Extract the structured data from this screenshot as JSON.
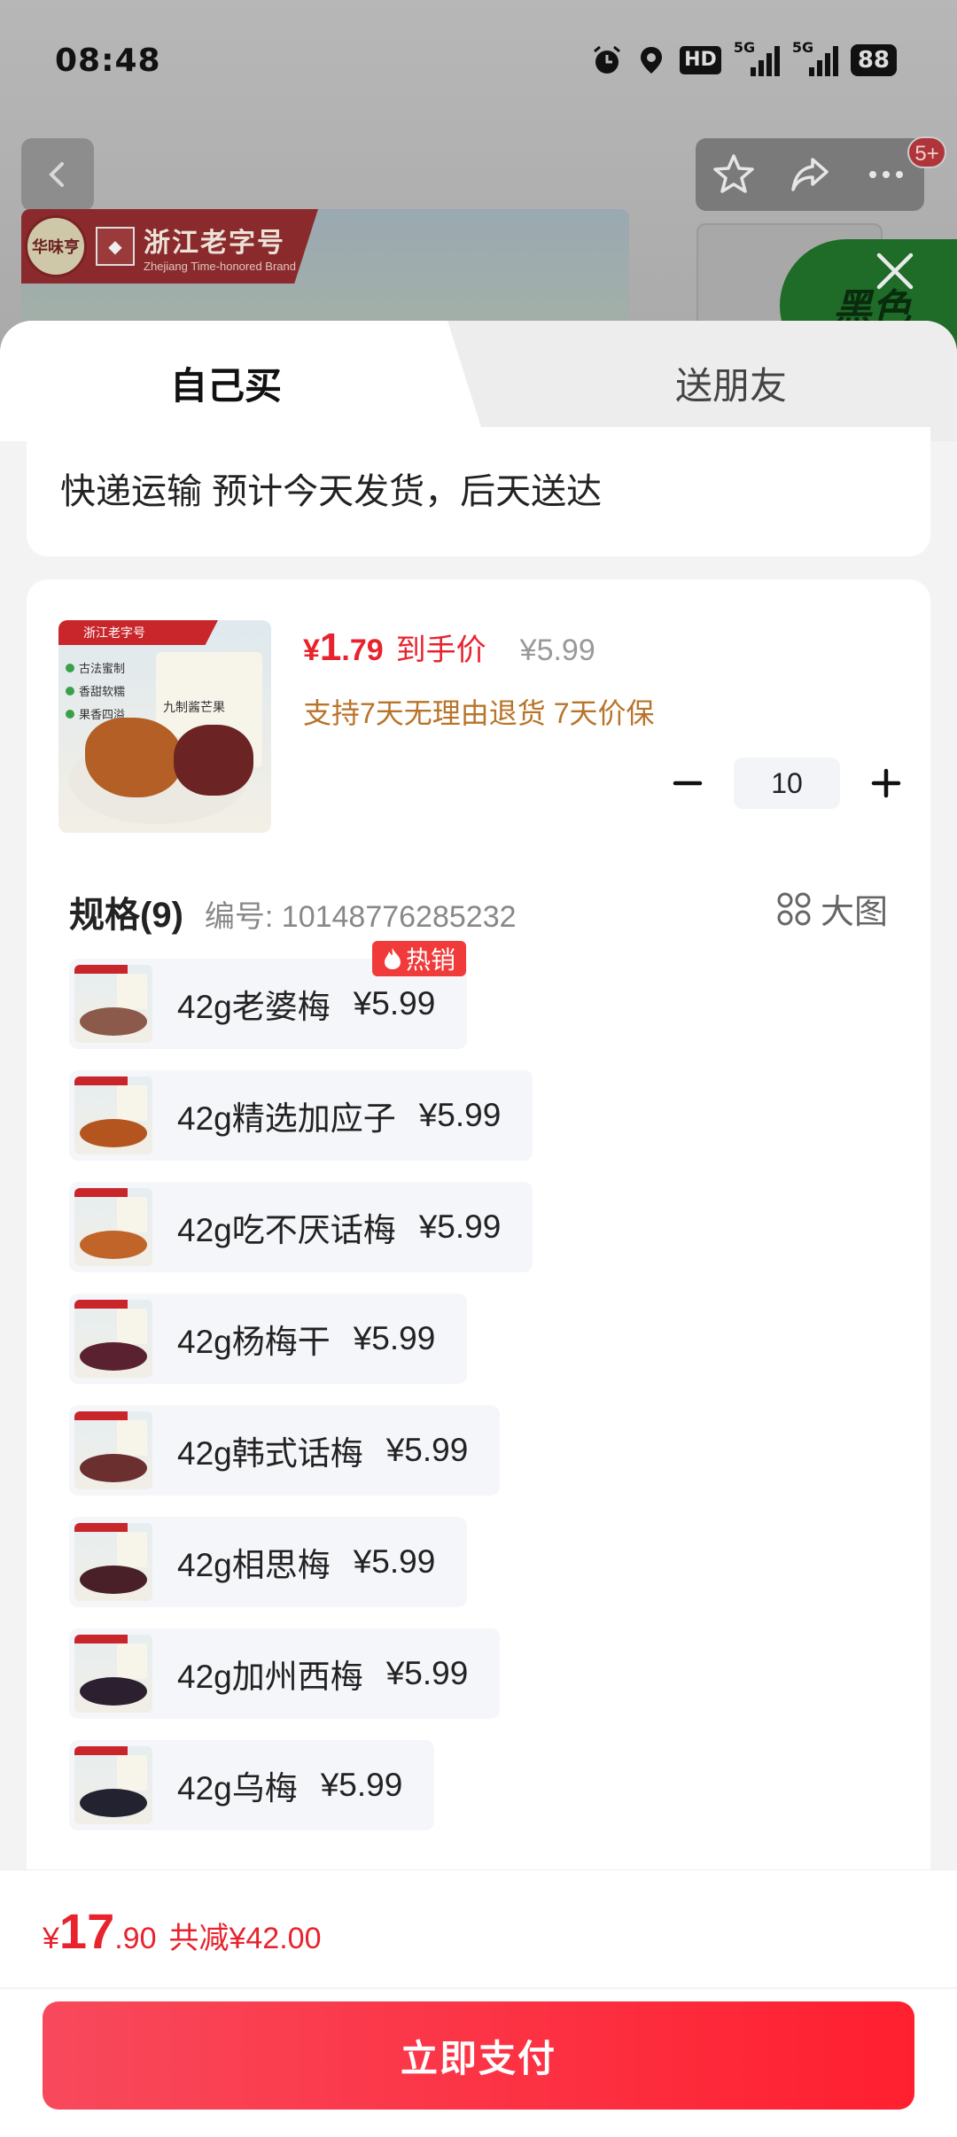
{
  "status_bar": {
    "time": "08:48",
    "hd": "HD",
    "net1": "5G",
    "net2": "5G",
    "battery": "88"
  },
  "background_page": {
    "badge_count": "5+",
    "brand_name": "浙江老字号",
    "brand_sub": "Zhejiang Time-honored Brand",
    "brand_logo_text": "华味亨",
    "promo_text": "黑色"
  },
  "tabs": {
    "self": "自己买",
    "friend": "送朋友"
  },
  "delivery": {
    "text": "快递运输 预计今天发货，后天送达"
  },
  "product": {
    "price_currency": "¥",
    "price_int": "1",
    "price_dec": ".79",
    "price_label": "到手价",
    "original_price": "¥5.99",
    "guarantee": "支持7天无理由退货 7天价保",
    "image": {
      "header": "浙江老字号",
      "tags": [
        "古法蜜制",
        "香甜软糯",
        "果香四溢"
      ],
      "bag_label": "九制酱芒果"
    }
  },
  "quantity": {
    "minus": "−",
    "value": "10",
    "plus": "+"
  },
  "specs": {
    "title": "规格(9)",
    "code": "编号: 10148776285232",
    "big_image": "大图",
    "hot_label": "热销",
    "items": [
      {
        "name": "42g老婆梅",
        "price": "¥5.99",
        "food_color": "#8b5a4a"
      },
      {
        "name": "42g精选加应子",
        "price": "¥5.99",
        "food_color": "#b4551f"
      },
      {
        "name": "42g吃不厌话梅",
        "price": "¥5.99",
        "food_color": "#c0642a"
      },
      {
        "name": "42g杨梅干",
        "price": "¥5.99",
        "food_color": "#5a2230"
      },
      {
        "name": "42g韩式话梅",
        "price": "¥5.99",
        "food_color": "#6b2f30"
      },
      {
        "name": "42g相思梅",
        "price": "¥5.99",
        "food_color": "#4a2028"
      },
      {
        "name": "42g加州西梅",
        "price": "¥5.99",
        "food_color": "#2c2030"
      },
      {
        "name": "42g乌梅",
        "price": "¥5.99",
        "food_color": "#222230"
      }
    ]
  },
  "footer": {
    "currency": "¥",
    "total_int": "17",
    "total_dec": ".90",
    "savings": "共减¥42.00",
    "pay_button": "立即支付"
  },
  "colors": {
    "accent": "#e8232d",
    "guarantee": "#b8742a",
    "pay_start": "#f8495c",
    "pay_end": "#ff1f2f"
  }
}
